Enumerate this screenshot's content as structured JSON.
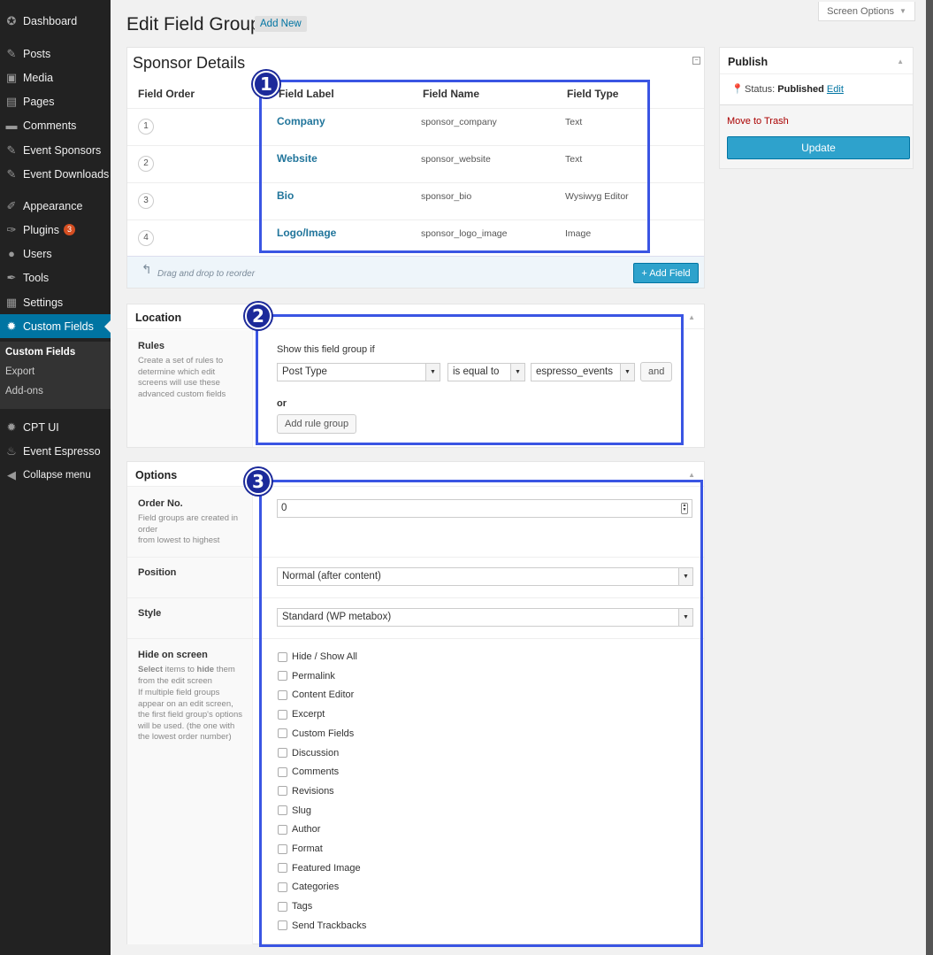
{
  "sidebar": {
    "items": [
      {
        "label": "Dashboard",
        "icon": "dashboard-icon",
        "glyph": "✪"
      },
      {
        "label": "Posts",
        "icon": "pushpin-icon",
        "glyph": "✎"
      },
      {
        "label": "Media",
        "icon": "media-icon",
        "glyph": "▣"
      },
      {
        "label": "Pages",
        "icon": "page-icon",
        "glyph": "▤"
      },
      {
        "label": "Comments",
        "icon": "comment-icon",
        "glyph": "▬"
      },
      {
        "label": "Event Sponsors",
        "icon": "pushpin-icon",
        "glyph": "✎"
      },
      {
        "label": "Event Downloads",
        "icon": "pushpin-icon",
        "glyph": "✎"
      },
      {
        "label": "Appearance",
        "icon": "paintbrush-icon",
        "glyph": "✐"
      },
      {
        "label": "Plugins",
        "icon": "plugin-icon",
        "glyph": "✑",
        "badge": "3"
      },
      {
        "label": "Users",
        "icon": "user-icon",
        "glyph": "●"
      },
      {
        "label": "Tools",
        "icon": "wrench-icon",
        "glyph": "✒"
      },
      {
        "label": "Settings",
        "icon": "settings-icon",
        "glyph": "▦"
      },
      {
        "label": "Custom Fields",
        "icon": "gear-icon",
        "glyph": "✹"
      },
      {
        "label": "CPT UI",
        "icon": "gear-icon",
        "glyph": "✹"
      },
      {
        "label": "Event Espresso",
        "icon": "coffee-icon",
        "glyph": "♨"
      },
      {
        "label": "Collapse menu",
        "icon": "collapse-icon",
        "glyph": "◀"
      }
    ],
    "submenu": [
      "Custom Fields",
      "Export",
      "Add-ons"
    ]
  },
  "screen_options": "Screen Options",
  "page_title": "Edit Field Group",
  "add_new": "Add New",
  "field_group": {
    "title": "Sponsor Details",
    "columns": {
      "order": "Field Order",
      "label": "Field Label",
      "name": "Field Name",
      "type": "Field Type"
    },
    "fields": [
      {
        "order": "1",
        "label": "Company",
        "name": "sponsor_company",
        "type": "Text"
      },
      {
        "order": "2",
        "label": "Website",
        "name": "sponsor_website",
        "type": "Text"
      },
      {
        "order": "3",
        "label": "Bio",
        "name": "sponsor_bio",
        "type": "Wysiwyg Editor"
      },
      {
        "order": "4",
        "label": "Logo/Image",
        "name": "sponsor_logo_image",
        "type": "Image"
      }
    ],
    "reorder_hint": "Drag and drop to reorder",
    "add_field": "+ Add Field"
  },
  "location": {
    "title": "Location",
    "rules_label": "Rules",
    "rules_desc": "Create a set of rules to determine which edit screens will use these advanced custom fields",
    "show_if": "Show this field group if",
    "param": "Post Type",
    "operator": "is equal to",
    "value": "espresso_events",
    "and": "and",
    "or": "or",
    "add_rule_group": "Add rule group"
  },
  "options": {
    "title": "Options",
    "order_label": "Order No.",
    "order_desc_1": "Field groups are created in order",
    "order_desc_2": "from lowest to highest",
    "order_value": "0",
    "position_label": "Position",
    "position_value": "Normal (after content)",
    "style_label": "Style",
    "style_value": "Standard (WP metabox)",
    "hide_label": "Hide on screen",
    "hide_desc_select": "Select",
    "hide_desc_items_to": " items to ",
    "hide_desc_hide": "hide",
    "hide_desc_them": " them from the edit screen",
    "hide_desc_2": "If multiple field groups appear on an edit screen, the first field group's options will be used. (the one with the lowest order number)",
    "hide_items": [
      "Hide / Show All",
      "Permalink",
      "Content Editor",
      "Excerpt",
      "Custom Fields",
      "Discussion",
      "Comments",
      "Revisions",
      "Slug",
      "Author",
      "Format",
      "Featured Image",
      "Categories",
      "Tags",
      "Send Trackbacks"
    ]
  },
  "publish": {
    "title": "Publish",
    "status_label": "Status: ",
    "status_value": "Published",
    "edit_link": "Edit",
    "trash": "Move to Trash",
    "update": "Update"
  },
  "callouts": [
    "1",
    "2",
    "3"
  ],
  "colors": {
    "accent": "#0074a2",
    "callout": "#3a55e3",
    "button": "#2ea2cc",
    "trash": "#aa0000"
  }
}
